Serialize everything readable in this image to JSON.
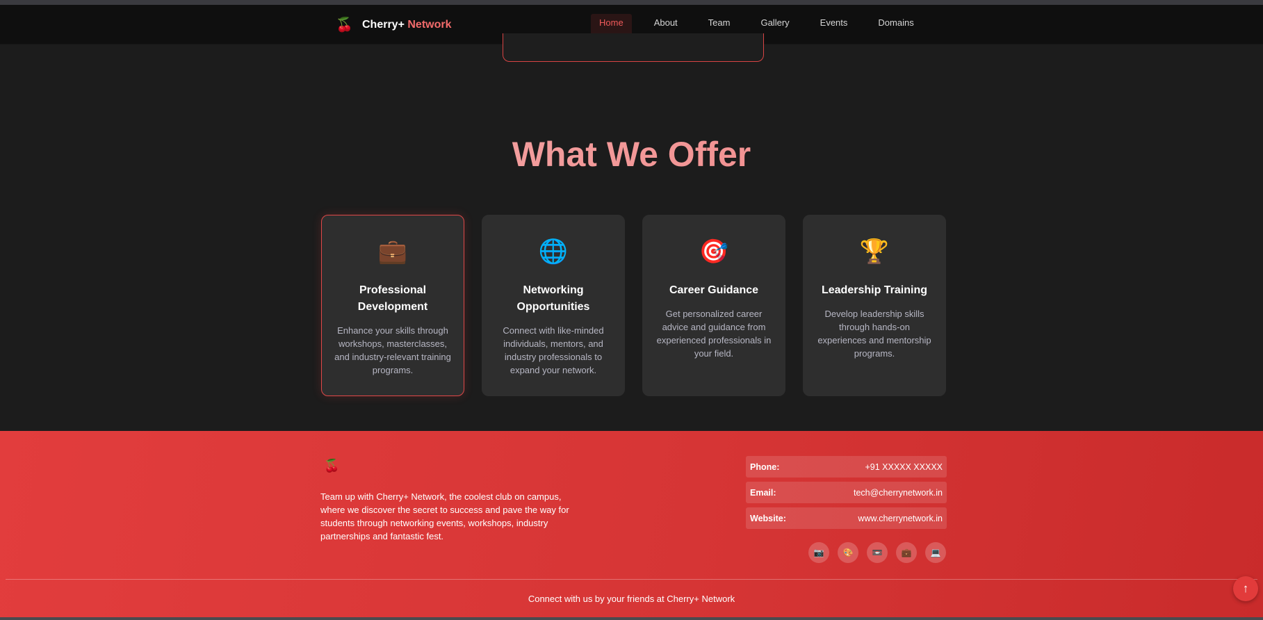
{
  "navbar": {
    "brand_icon": "🍒",
    "brand_name": "Cherry+",
    "brand_accent": "Network",
    "links": [
      "Home",
      "About",
      "Team",
      "Gallery",
      "Events",
      "Domains"
    ],
    "active": "Home"
  },
  "offers": {
    "title": "What We Offer",
    "cards": [
      {
        "icon": "💼",
        "icon_name": "briefcase-icon",
        "title": "Professional Development",
        "desc": "Enhance your skills through workshops, masterclasses, and industry-relevant training programs."
      },
      {
        "icon": "🌐",
        "icon_name": "globe-icon",
        "title": "Networking Opportunities",
        "desc": "Connect with like-minded individuals, mentors, and industry professionals to expand your network."
      },
      {
        "icon": "🎯",
        "icon_name": "target-icon",
        "title": "Career Guidance",
        "desc": "Get personalized career advice and guidance from experienced professionals in your field."
      },
      {
        "icon": "🏆",
        "icon_name": "trophy-icon",
        "title": "Leadership Training",
        "desc": "Develop leadership skills through hands-on experiences and mentorship programs."
      }
    ]
  },
  "footer": {
    "logo_icon": "🍒",
    "about": "Team up with Cherry+ Network, the coolest club on campus, where we discover the secret to success and pave the way for students through networking events, workshops, industry partnerships and fantastic fest.",
    "contact": [
      {
        "label": "Phone:",
        "value": "+91 XXXXX XXXXX"
      },
      {
        "label": "Email:",
        "value": "tech@cherrynetwork.in"
      },
      {
        "label": "Website:",
        "value": "www.cherrynetwork.in"
      }
    ],
    "socials": [
      {
        "icon": "📷",
        "name": "camera-icon"
      },
      {
        "icon": "🎨",
        "name": "palette-icon"
      },
      {
        "icon": "📼",
        "name": "tape-icon"
      },
      {
        "icon": "💼",
        "name": "briefcase-icon"
      },
      {
        "icon": "💻",
        "name": "laptop-icon"
      }
    ],
    "bottom_text": "Connect with us by your friends at Cherry+ Network",
    "scroll_top_icon": "↑"
  },
  "colors": {
    "accent": "#e23d3d",
    "page_bg": "#1c1c1c",
    "card_bg": "#2e2e2e",
    "title_gradient_start": "#f5b3b3",
    "title_gradient_end": "#ef7d7d"
  }
}
